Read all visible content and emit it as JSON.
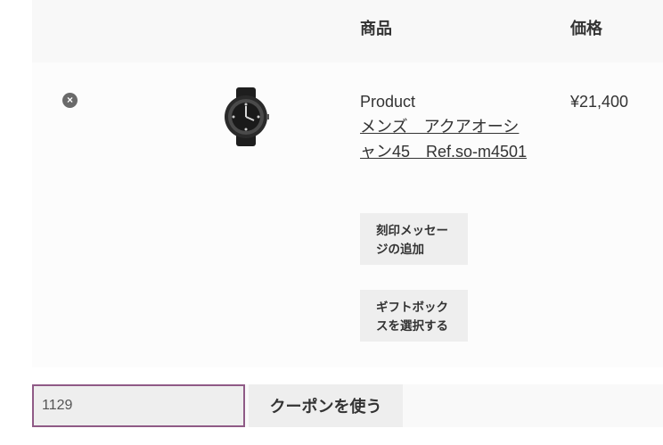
{
  "table": {
    "header_product": "商品",
    "header_price": "価格"
  },
  "cart_item": {
    "remove_symbol": "×",
    "product_label": "Product",
    "product_name": "メンズ　アクアオーシャン45　Ref.so-m4501",
    "engrave_button": "刻印メッセージの追加",
    "gift_button": "ギフトボックスを選択する",
    "price": "¥21,400"
  },
  "coupon": {
    "input_value": "1129",
    "apply_button": "クーポンを使う"
  },
  "colors": {
    "input_border": "#8f5a86",
    "button_bg": "#eeeeee"
  }
}
